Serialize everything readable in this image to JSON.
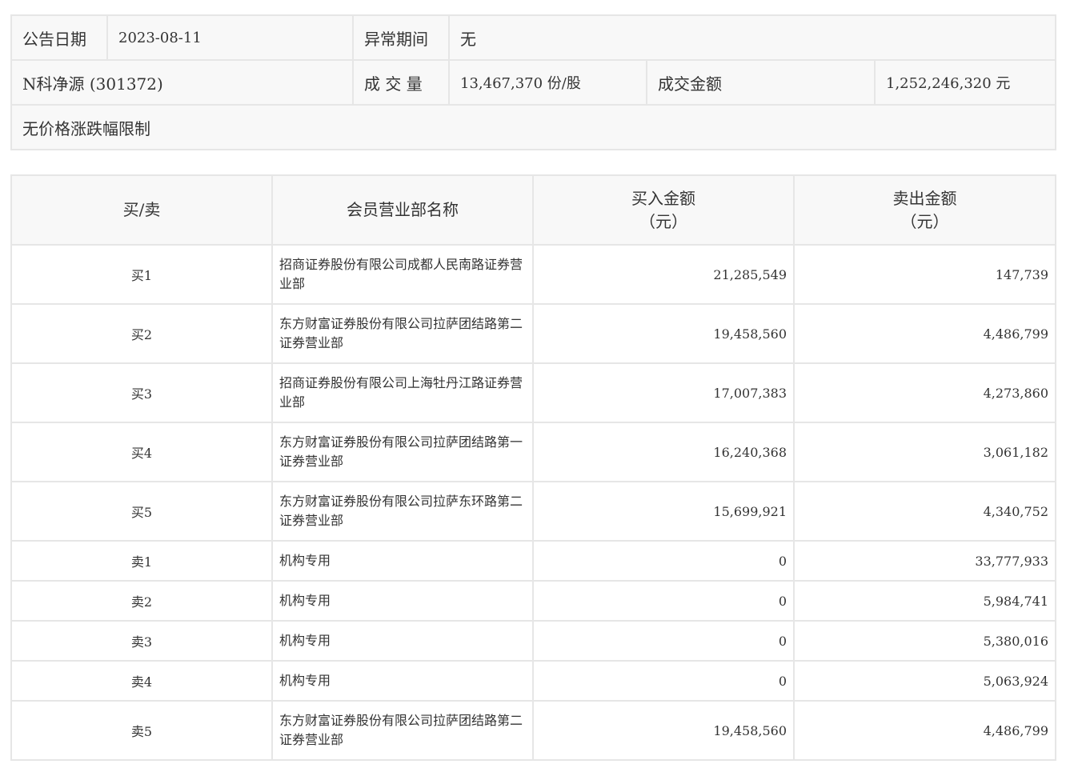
{
  "info": {
    "announce_date_label": "公告日期",
    "announce_date_value": "2023-08-11",
    "abnormal_period_label": "异常期间",
    "abnormal_period_value": "无",
    "stock": "N科净源 (301372)",
    "volume_label": "成 交 量",
    "volume_value": "13,467,370 份/股",
    "amount_label": "成交金额",
    "amount_value": "1,252,246,320 元",
    "limit_note": "无价格涨跌幅限制"
  },
  "table": {
    "headers": {
      "type": "买/卖",
      "dept": "会员营业部名称",
      "buy": "买入金额",
      "buy_unit": "（元）",
      "sell": "卖出金额",
      "sell_unit": "（元）"
    },
    "rows": [
      {
        "type": "买1",
        "dept": "招商证券股份有限公司成都人民南路证券营业部",
        "buy": "21,285,549",
        "sell": "147,739"
      },
      {
        "type": "买2",
        "dept": "东方财富证券股份有限公司拉萨团结路第二证券营业部",
        "buy": "19,458,560",
        "sell": "4,486,799"
      },
      {
        "type": "买3",
        "dept": "招商证券股份有限公司上海牡丹江路证券营业部",
        "buy": "17,007,383",
        "sell": "4,273,860"
      },
      {
        "type": "买4",
        "dept": "东方财富证券股份有限公司拉萨团结路第一证券营业部",
        "buy": "16,240,368",
        "sell": "3,061,182"
      },
      {
        "type": "买5",
        "dept": "东方财富证券股份有限公司拉萨东环路第二证券营业部",
        "buy": "15,699,921",
        "sell": "4,340,752"
      },
      {
        "type": "卖1",
        "dept": "机构专用",
        "buy": "0",
        "sell": "33,777,933"
      },
      {
        "type": "卖2",
        "dept": "机构专用",
        "buy": "0",
        "sell": "5,984,741"
      },
      {
        "type": "卖3",
        "dept": "机构专用",
        "buy": "0",
        "sell": "5,380,016"
      },
      {
        "type": "卖4",
        "dept": "机构专用",
        "buy": "0",
        "sell": "5,063,924"
      },
      {
        "type": "卖5",
        "dept": "东方财富证券股份有限公司拉萨团结路第二证券营业部",
        "buy": "19,458,560",
        "sell": "4,486,799"
      }
    ]
  }
}
